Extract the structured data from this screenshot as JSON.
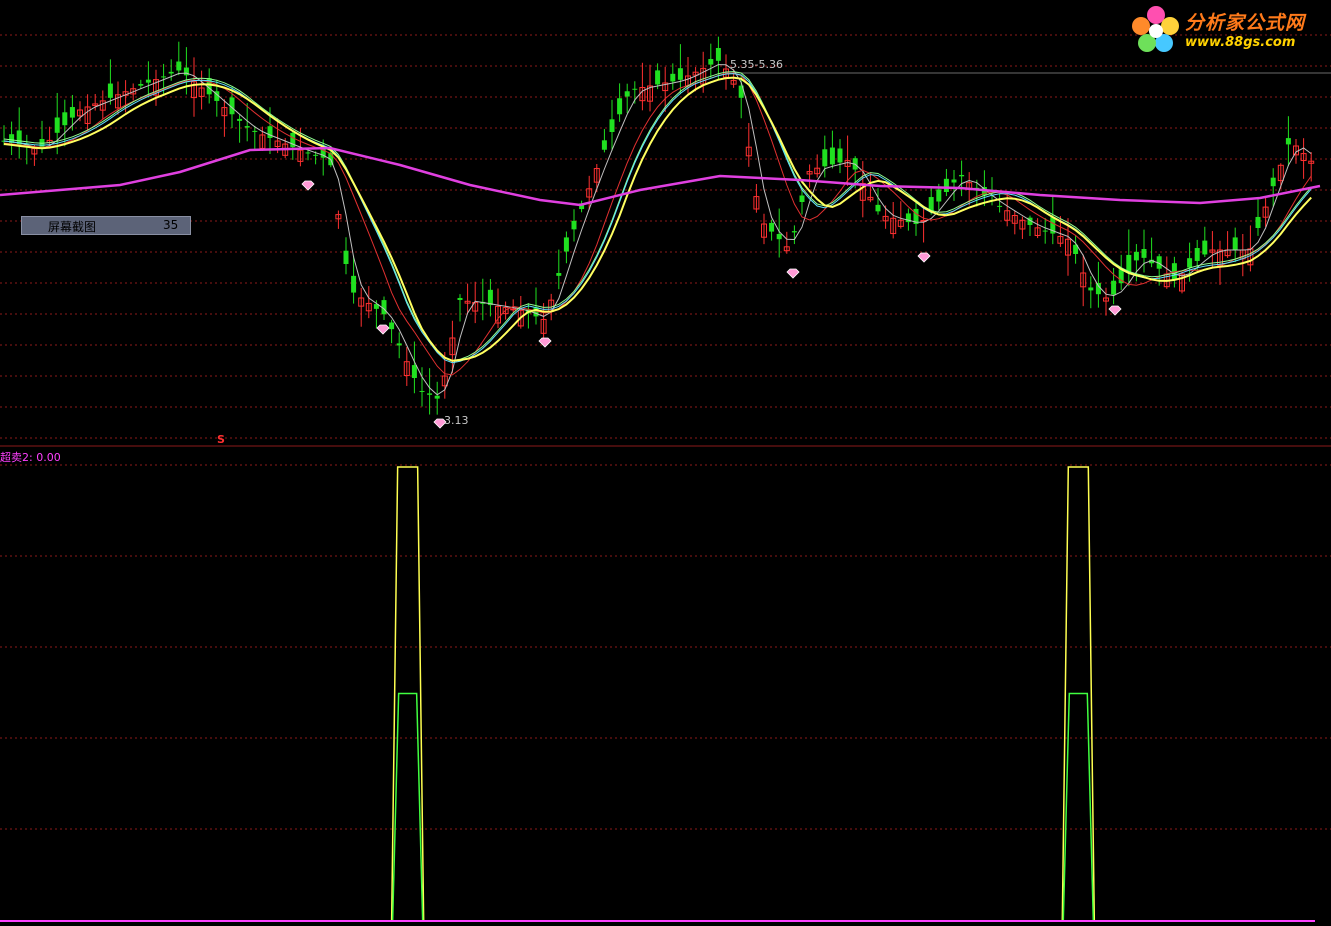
{
  "logo": {
    "name": "分析家公式网",
    "url": "www.88gs.com"
  },
  "tooltip": {
    "label": "屏幕截图",
    "value": "35"
  },
  "annotations": {
    "high": "5.35-5.36",
    "low": "3.13",
    "marker": "S"
  },
  "colors": {
    "background": "#000000",
    "up_candle": "#ff3030",
    "down_candle": "#20e020",
    "grid": "#8b1a1a",
    "ma_yellow": "#ffff60",
    "ma_magenta": "#e040e0",
    "ma_cyan": "#60e0ff",
    "ma_green": "#90ff90",
    "ma_red": "#e03030",
    "signal_yellow": "#ffff50",
    "signal_green": "#40ff40",
    "baseline": "#ff40ff"
  },
  "chart_data": [
    {
      "type": "candlestick",
      "indicators": [
        "ma_short",
        "ma_medium",
        "ma_long",
        "ma_very_long"
      ],
      "grid": true,
      "markers": [
        "diamond-icon"
      ]
    },
    {
      "type": "line",
      "title": "超卖2: 0.00",
      "series": [
        {
          "color": "#ffff50",
          "peaks": [
            {
              "x_index": 0.31,
              "level": 1.0
            },
            {
              "x_index": 0.82,
              "level": 1.0
            }
          ]
        },
        {
          "color": "#40ff40",
          "peaks": [
            {
              "x_index": 0.31,
              "level": 0.5
            },
            {
              "x_index": 0.82,
              "level": 0.5
            }
          ]
        }
      ]
    }
  ]
}
